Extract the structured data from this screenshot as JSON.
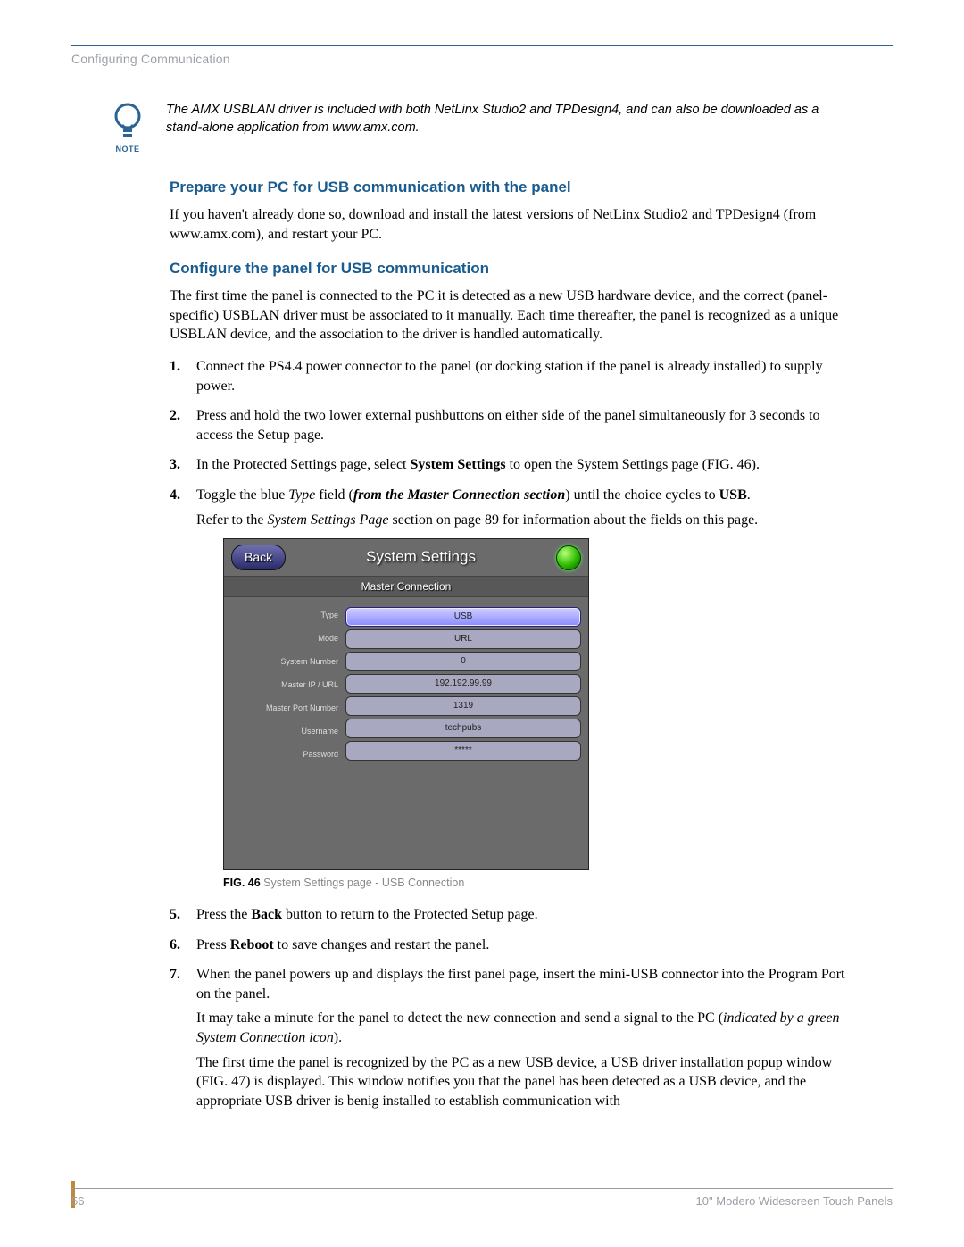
{
  "header": {
    "section_label": "Configuring Communication"
  },
  "note": {
    "label": "NOTE",
    "text": "The AMX USBLAN driver is included with both NetLinx Studio2 and TPDesign4, and can also be downloaded as a stand-alone application from www.amx.com."
  },
  "sections": {
    "prepare": {
      "heading": "Prepare your PC for USB communication with the panel",
      "p1": "If you haven't already done so, download and install the latest versions of NetLinx Studio2 and TPDesign4 (from www.amx.com), and restart your PC."
    },
    "configure": {
      "heading": "Configure the panel for USB communication",
      "intro": "The first time the panel is connected to the PC it is detected as a new USB hardware device, and the correct (panel-specific) USBLAN driver must be associated to it manually. Each time thereafter, the panel is recognized as a unique USBLAN device, and the association to the driver is handled automatically.",
      "steps": {
        "s1": "Connect the PS4.4 power connector to the panel (or docking station if the panel is already installed) to supply power.",
        "s2": "Press and hold the two lower external pushbuttons on either side of the panel simultaneously for 3 seconds to access the Setup page.",
        "s3_a": "In the Protected Settings page, select ",
        "s3_b": "System Settings",
        "s3_c": " to open the System Settings page (FIG. 46).",
        "s4_a": "Toggle the blue ",
        "s4_b": "Type",
        "s4_c": " field (",
        "s4_d": "from the Master Connection section",
        "s4_e": ") until the choice cycles to ",
        "s4_f": "USB",
        "s4_g": ".",
        "s4_ref_a": "Refer to the ",
        "s4_ref_b": "System Settings Page",
        "s4_ref_c": " section on page 89 for information about the fields on this page.",
        "s5_a": "Press the ",
        "s5_b": "Back",
        "s5_c": " button to return to the Protected Setup page.",
        "s6_a": "Press ",
        "s6_b": "Reboot",
        "s6_c": " to save changes and restart the panel.",
        "s7": "When the panel powers up and displays the first panel page, insert the mini-USB connector into the Program Port on the panel.",
        "s7_p2_a": "It may take a minute for the panel to detect the new connection and send a signal to the PC (",
        "s7_p2_b": "indicated by a green System Connection icon",
        "s7_p2_c": ").",
        "s7_p3": "The first time the panel is recognized by the PC as a new USB device, a USB driver installation popup window (FIG. 47) is displayed. This window notifies you that the panel has been detected as a USB device, and the appropriate USB driver is benig installed to establish communication with"
      }
    }
  },
  "figure": {
    "back_label": "Back",
    "title": "System Settings",
    "mc_header": "Master Connection",
    "rows": [
      {
        "label": "Type",
        "value": "USB",
        "selected": true
      },
      {
        "label": "Mode",
        "value": "URL",
        "selected": false
      },
      {
        "label": "System Number",
        "value": "0",
        "selected": false
      },
      {
        "label": "Master IP / URL",
        "value": "192.192.99.99",
        "selected": false
      },
      {
        "label": "Master Port Number",
        "value": "1319",
        "selected": false
      },
      {
        "label": "Username",
        "value": "techpubs",
        "selected": false
      },
      {
        "label": "Password",
        "value": "*****",
        "selected": false
      }
    ],
    "caption_no": "FIG. 46",
    "caption_text": "  System Settings page - USB Connection"
  },
  "footer": {
    "page_no": "56",
    "doc_title": "10\" Modero Widescreen Touch Panels"
  }
}
